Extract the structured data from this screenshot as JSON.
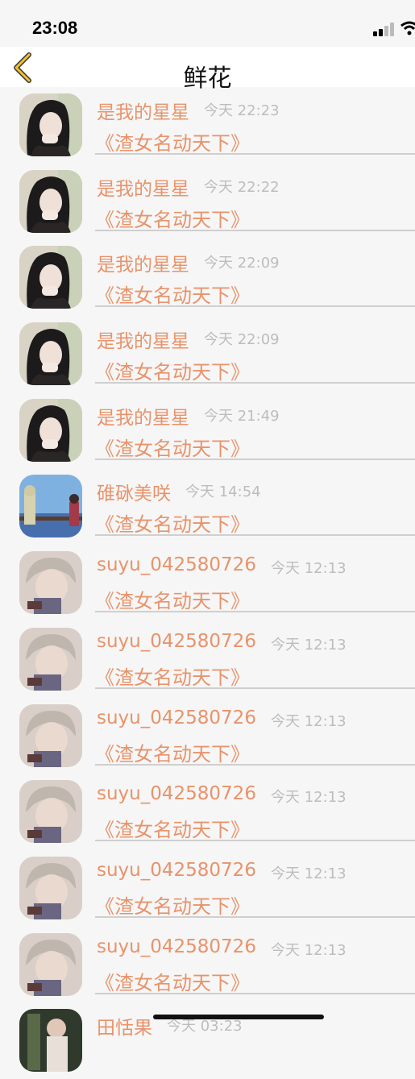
{
  "status": {
    "time": "23:08"
  },
  "nav": {
    "title": "鲜花",
    "back_icon": "chevron-left-icon",
    "accent": "#f2c12e"
  },
  "colors": {
    "name": "#e8936b",
    "message": "#e8936b",
    "time": "#bdbdbd"
  },
  "rows": [
    {
      "name": "是我的星星",
      "time": "今天 22:23",
      "message": "《渣女名动天下》",
      "avatar": "girl"
    },
    {
      "name": "是我的星星",
      "time": "今天 22:22",
      "message": "《渣女名动天下》",
      "avatar": "girl"
    },
    {
      "name": "是我的星星",
      "time": "今天 22:09",
      "message": "《渣女名动天下》",
      "avatar": "girl"
    },
    {
      "name": "是我的星星",
      "time": "今天 22:09",
      "message": "《渣女名动天下》",
      "avatar": "girl"
    },
    {
      "name": "是我的星星",
      "time": "今天 21:49",
      "message": "《渣女名动天下》",
      "avatar": "girl"
    },
    {
      "name": "碓砯美咲",
      "time": "今天 14:54",
      "message": "《渣女名动天下》",
      "avatar": "anime"
    },
    {
      "name": "suyu_042580726",
      "time": "今天 12:13",
      "message": "《渣女名动天下》",
      "avatar": "boy"
    },
    {
      "name": "suyu_042580726",
      "time": "今天 12:13",
      "message": "《渣女名动天下》",
      "avatar": "boy"
    },
    {
      "name": "suyu_042580726",
      "time": "今天 12:13",
      "message": "《渣女名动天下》",
      "avatar": "boy"
    },
    {
      "name": "suyu_042580726",
      "time": "今天 12:13",
      "message": "《渣女名动天下》",
      "avatar": "boy"
    },
    {
      "name": "suyu_042580726",
      "time": "今天 12:13",
      "message": "《渣女名动天下》",
      "avatar": "boy"
    },
    {
      "name": "suyu_042580726",
      "time": "今天 12:13",
      "message": "《渣女名动天下》",
      "avatar": "boy"
    },
    {
      "name": "田恬果",
      "time": "今天 03:23",
      "message": "",
      "avatar": "photo"
    }
  ]
}
